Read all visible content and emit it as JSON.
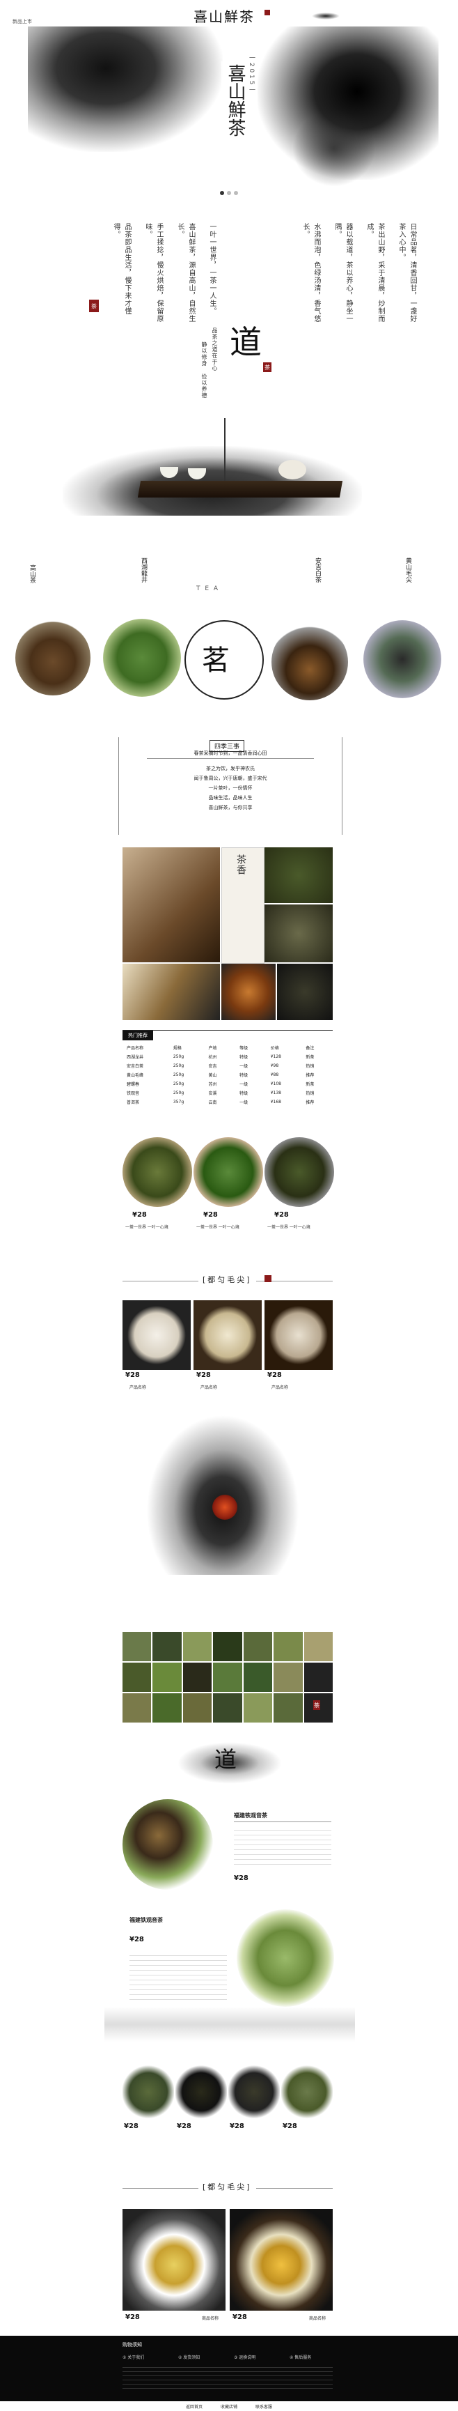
{
  "header": {
    "logo_text": "喜山鮮茶",
    "nav_items": [
      "新品上市"
    ]
  },
  "hero": {
    "title": "喜山鮮茶",
    "year": "一 2 0 1 5 一",
    "carousel_dots": 3
  },
  "intro": {
    "columns": [
      "日常品茗，清香回甘，一盏好茶入心中。",
      "茶出山野，采于清晨，炒制而成。",
      "器以载道，茶以养心，静坐一隅。",
      "水沸而泡，色绿汤清，香气悠长。",
      "一叶一世界，一茶一人生。",
      "喜山鲜茶，源自高山，自然生长。",
      "手工揉捻，慢火烘焙，保留原味。",
      "品茶即品生活，慢下来才懂得。"
    ],
    "seal_text": "茶"
  },
  "dao": {
    "char": "道",
    "lines": [
      "品茶之道在于心",
      "静以修身 俭以养德"
    ],
    "seal_text": "茶"
  },
  "tea_types": {
    "tea_label": "T E A",
    "items": [
      {
        "label": "高山茶"
      },
      {
        "label": "西湖龍井"
      },
      {
        "label": "安吉白茶"
      },
      {
        "label": "黄山毛尖"
      }
    ],
    "center_char": "茗"
  },
  "story_box": {
    "title": "四季三事",
    "lines": [
      "春茶采摘时节到，一品清香润心田",
      "茶之为饮，发乎神农氏",
      "闻于鲁周公，兴于唐朝，盛于宋代",
      "一片茶叶，一份情怀",
      "品味生活，品味人生",
      "喜山鲜茶，与你共享"
    ]
  },
  "gallery": {
    "brand_vertical": "茶香"
  },
  "hot_table": {
    "tag": "热门推荐",
    "header": [
      "产品名称",
      "规格",
      "产地",
      "等级",
      "价格",
      "备注"
    ],
    "rows": [
      [
        "西湖龙井",
        "250g",
        "杭州",
        "特级",
        "¥128",
        "新茶"
      ],
      [
        "安吉白茶",
        "250g",
        "安吉",
        "一级",
        "¥98",
        "热销"
      ],
      [
        "黄山毛峰",
        "250g",
        "黄山",
        "特级",
        "¥88",
        "推荐"
      ],
      [
        "碧螺春",
        "250g",
        "苏州",
        "一级",
        "¥108",
        "新茶"
      ],
      [
        "铁观音",
        "250g",
        "安溪",
        "特级",
        "¥138",
        "热销"
      ],
      [
        "普洱茶",
        "357g",
        "云南",
        "一级",
        "¥168",
        "推荐"
      ]
    ]
  },
  "circle_products": [
    {
      "price": "¥28",
      "desc": "一茶一世界 一叶一心境"
    },
    {
      "price": "¥28",
      "desc": "一茶一世界 一叶一心境"
    },
    {
      "price": "¥28",
      "desc": "一茶一世界 一叶一心境"
    }
  ],
  "section2": {
    "title": "[都匀毛尖]"
  },
  "cake_products": [
    {
      "price": "¥28",
      "label": "产品名称"
    },
    {
      "price": "¥28",
      "label": "产品名称"
    },
    {
      "price": "¥28",
      "label": "产品名称"
    }
  ],
  "grid": {
    "seal": "茶"
  },
  "dao2": {
    "char": "道"
  },
  "feature1": {
    "title": "福建铁观音茶",
    "price": "¥28"
  },
  "feature2": {
    "title": "福建铁观音茶",
    "price": "¥28"
  },
  "leaf_products": [
    {
      "price": "¥28"
    },
    {
      "price": "¥28"
    },
    {
      "price": "¥28"
    },
    {
      "price": "¥28"
    }
  ],
  "section3": {
    "title": "[都匀毛尖]"
  },
  "cup_products": [
    {
      "price": "¥28",
      "label": "商品名称"
    },
    {
      "price": "¥28",
      "label": "商品名称"
    }
  ],
  "footer": {
    "heading": "购物须知",
    "cols": [
      "① 关于我们",
      "② 发货须知",
      "③ 退换说明",
      "④ 售后服务"
    ],
    "links": [
      "返回首页",
      "收藏店铺",
      "联系客服"
    ]
  }
}
